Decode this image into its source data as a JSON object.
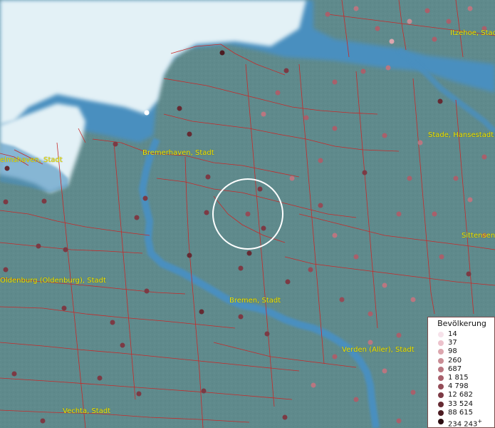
{
  "labels": [
    {
      "id": "itzehoe",
      "text": "Itzehoe, Stadt"
    },
    {
      "id": "stade",
      "text": "Stade, Hansestadt"
    },
    {
      "id": "bremerhaven",
      "text": "Bremerhaven, Stadt"
    },
    {
      "id": "wilhelmshaven",
      "text": "elmshaven, Stadt"
    },
    {
      "id": "sittensen",
      "text": "Sittensen"
    },
    {
      "id": "oldenburg",
      "text": "Oldenburg (Oldenburg), Stadt"
    },
    {
      "id": "bremen",
      "text": "Bremen, Stadt"
    },
    {
      "id": "verden",
      "text": "Verden (Aller), Stadt"
    },
    {
      "id": "vechta",
      "text": "Vechta, Stadt"
    }
  ],
  "legend": {
    "title": "Bevölkerung",
    "classes": [
      {
        "label": "14",
        "color": "#f6e2ea"
      },
      {
        "label": "37",
        "color": "#ecc2cc"
      },
      {
        "label": "98",
        "color": "#dca6ae"
      },
      {
        "label": "260",
        "color": "#c98d95"
      },
      {
        "label": "687",
        "color": "#b97680"
      },
      {
        "label": "1 815",
        "color": "#a8606b"
      },
      {
        "label": "4 798",
        "color": "#944c57"
      },
      {
        "label": "12 682",
        "color": "#7c3a44"
      },
      {
        "label": "33 524",
        "color": "#652a32"
      },
      {
        "label": "88 615",
        "color": "#4c1c22"
      },
      {
        "label": "234 243",
        "color": "#2a0c10"
      }
    ],
    "open_end_marker": "+"
  },
  "colors": {
    "land": "#5f8a8c",
    "water": "#4a8fbf",
    "sea_ice": "#e3f1f6",
    "boundaries": "#c62a2a",
    "label_text": "#f2e600",
    "highlight_ring": "#ffffff"
  }
}
